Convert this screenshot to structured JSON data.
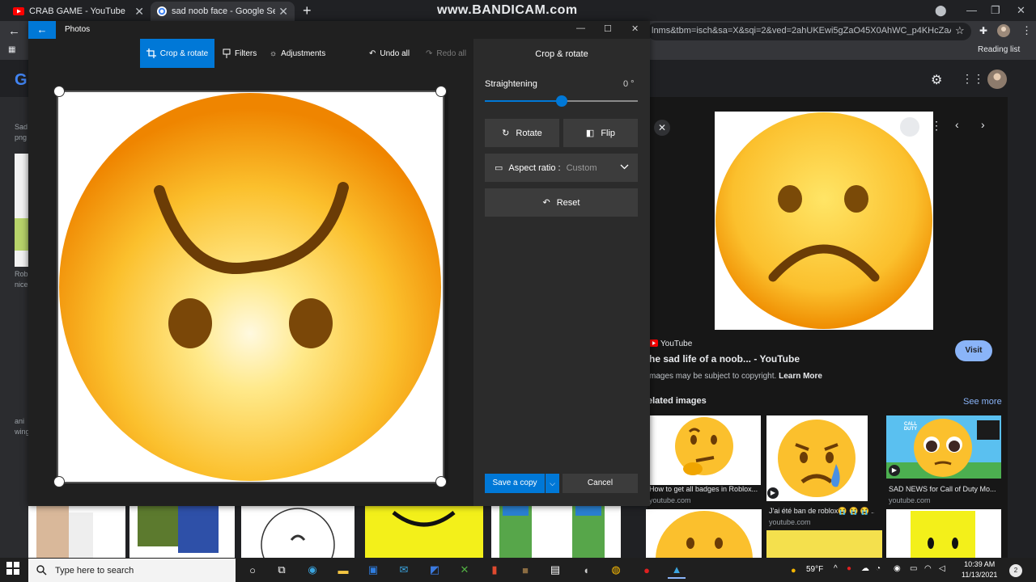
{
  "browser": {
    "tabs": [
      {
        "title": "CRAB GAME - YouTube",
        "active": false
      },
      {
        "title": "sad noob face - Google Search",
        "active": true
      }
    ],
    "watermark": "www.BANDICAM.com",
    "url": "lnms&tbm=isch&sa=X&sqi=2&ved=2ahUKEwi5gZaO45X0AhWC_p4KHcZaAI...",
    "reading_list": "Reading list"
  },
  "google": {
    "left_labels": [
      "Sad",
      "png",
      "Rob",
      "nice",
      "ani",
      "wing"
    ],
    "result": {
      "source": "YouTube",
      "title": "he sad life of a noob... - YouTube",
      "copyright": "mages may be subject to copyright.",
      "learn_more": "Learn More",
      "visit": "Visit"
    },
    "related_title": "elated images",
    "see_more": "See more",
    "related": [
      {
        "caption": "How to get all badges in Roblox...",
        "source": "youtube.com"
      },
      {
        "caption": "J'ai été ban de roblox😭 😭 😭 ...",
        "source": "youtube.com"
      },
      {
        "caption": "SAD NEWS for Call of Duty Mo...",
        "source": "youtube.com"
      }
    ],
    "cod_badge": "CALL DUTY"
  },
  "photos": {
    "app_title": "Photos",
    "commands": {
      "crop_rotate": "Crop & rotate",
      "filters": "Filters",
      "adjustments": "Adjustments",
      "undo_all": "Undo all",
      "redo_all": "Redo all"
    },
    "panel": {
      "title": "Crop & rotate",
      "straightening_label": "Straightening",
      "straightening_value": "0 °",
      "straightening_level": 0.5,
      "rotate": "Rotate",
      "flip": "Flip",
      "aspect_label": "Aspect ratio :",
      "aspect_value": "Custom",
      "reset": "Reset",
      "save_copy": "Save a copy",
      "cancel": "Cancel"
    }
  },
  "taskbar": {
    "search_placeholder": "Type here to search",
    "temperature": "59°F",
    "time": "10:39 AM",
    "date": "11/13/2021",
    "notifications": "2"
  },
  "colors": {
    "accent": "#0078d7",
    "chrome_dark": "#202124",
    "panel": "#2b2b2b",
    "link": "#8ab4f8"
  }
}
